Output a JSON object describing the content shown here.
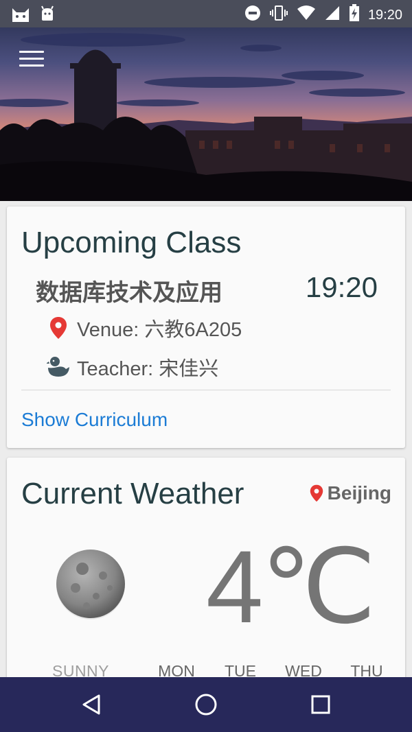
{
  "status_bar": {
    "time": "19:20",
    "left_icons": [
      "cat-notification-icon",
      "android-notification-icon"
    ],
    "right_icons": [
      "do-not-disturb-icon",
      "vibrate-icon",
      "wifi-icon",
      "signal-icon",
      "battery-charging-icon"
    ]
  },
  "header": {
    "menu_icon": "hamburger-menu-icon"
  },
  "upcoming_class": {
    "title": "Upcoming Class",
    "course_name": "数据库技术及应用",
    "time": "19:20",
    "venue": "Venue: 六教6A205",
    "teacher": "Teacher: 宋佳兴",
    "venue_icon": "location-pin-icon",
    "teacher_icon": "duck-icon",
    "link_label": "Show Curriculum"
  },
  "weather": {
    "title": "Current Weather",
    "location": "Beijing",
    "location_icon": "location-pin-icon",
    "weather_icon": "moon-icon",
    "temperature": "4℃",
    "condition": "SUNNY",
    "forecast_days": [
      "MON",
      "TUE",
      "WED",
      "THU"
    ]
  },
  "colors": {
    "title": "#263f44",
    "link": "#1c7cd5",
    "pin": "#e53935",
    "nav_bar": "#27285a",
    "status_bar": "#4a4d5a"
  },
  "nav": {
    "icons": [
      "back-icon",
      "home-icon",
      "recents-icon"
    ]
  }
}
